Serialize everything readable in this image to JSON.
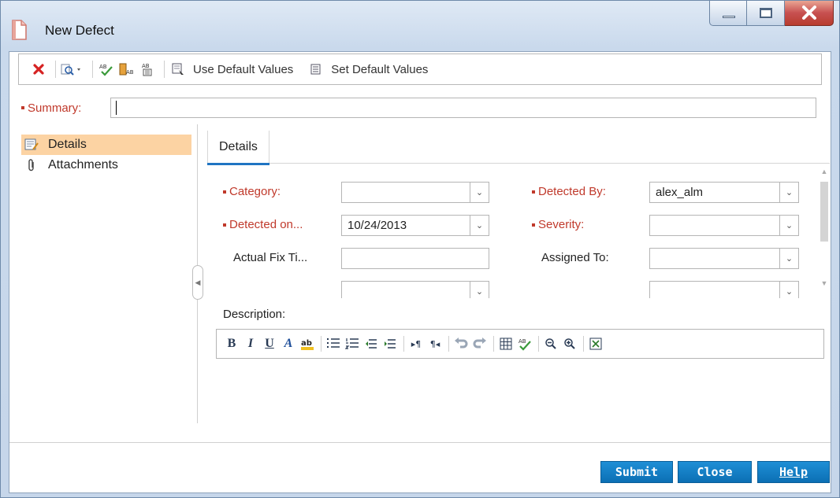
{
  "window": {
    "title": "New Defect"
  },
  "toolbar": {
    "use_default_label": "Use Default Values",
    "set_default_label": "Set Default Values"
  },
  "summary": {
    "label": "Summary:",
    "value": ""
  },
  "sidebar": {
    "items": [
      {
        "label": "Details",
        "icon": "details-icon",
        "active": true
      },
      {
        "label": "Attachments",
        "icon": "paperclip-icon",
        "active": false
      }
    ]
  },
  "tabs": [
    {
      "label": "Details",
      "active": true
    }
  ],
  "form": {
    "category": {
      "label": "Category:",
      "value": "",
      "required": true
    },
    "detected_by": {
      "label": "Detected By:",
      "value": "alex_alm",
      "required": true
    },
    "detected_on": {
      "label": "Detected on...",
      "value": "10/24/2013",
      "required": true
    },
    "severity": {
      "label": "Severity:",
      "value": "",
      "required": true
    },
    "actual_fix_time": {
      "label": "Actual Fix Ti...",
      "value": ""
    },
    "assigned_to": {
      "label": "Assigned To:",
      "value": ""
    }
  },
  "description": {
    "label": "Description:"
  },
  "buttons": {
    "submit": "Submit",
    "close": "Close",
    "help": "Help"
  },
  "colors": {
    "required": "#c0392b",
    "accent": "#1f74c2",
    "nav_active": "#fcd3a3",
    "button": "#0b6fb4"
  }
}
